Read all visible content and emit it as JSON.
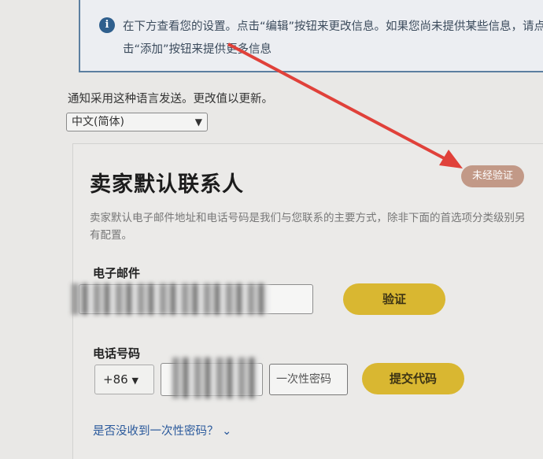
{
  "info_banner": {
    "text": "在下方查看您的设置。点击“编辑”按钮来更改信息。如果您尚未提供某些信息，请点击“添加”按钮来提供更多信息"
  },
  "language": {
    "label": "通知采用这种语言发送。更改值以更新。",
    "selected": "中文(简体)"
  },
  "contact_card": {
    "title": "卖家默认联系人",
    "status_badge": "未经验证",
    "description": "卖家默认电子邮件地址和电话号码是我们与您联系的主要方式，除非下面的首选项分类级别另有配置。",
    "email": {
      "label": "电子邮件",
      "verify_button": "验证"
    },
    "phone": {
      "label": "电话号码",
      "country_code": "+86",
      "otp_placeholder": "一次性密码",
      "submit_button": "提交代码"
    },
    "no_otp_link": "是否没收到一次性密码？"
  },
  "colors": {
    "badge": "#c29987",
    "primary_button": "#d9b731",
    "annotation_arrow": "#e0413a"
  },
  "icons": {
    "info": "info-circle-icon",
    "chevron": "chevron-down-icon"
  }
}
